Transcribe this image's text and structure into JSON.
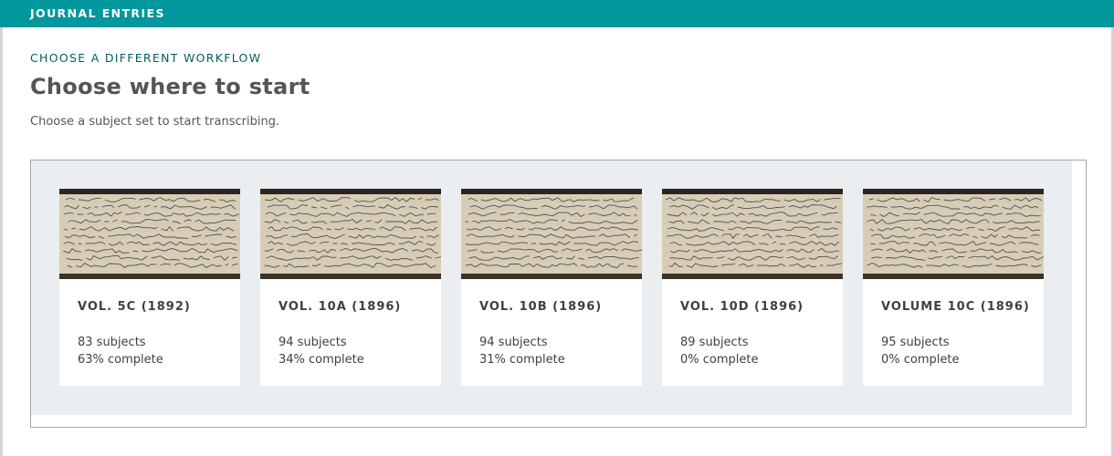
{
  "header": {
    "title": "JOURNAL ENTRIES",
    "color": "#00979d"
  },
  "workflow_link": "CHOOSE A DIFFERENT WORKFLOW",
  "page_title": "Choose where to start",
  "subtitle": "Choose a subject set to start transcribing.",
  "subject_sets": [
    {
      "title": "VOL. 5C (1892)",
      "subjects": "83 subjects",
      "complete": "63% complete",
      "thumbnail_icon": "handwritten-journal-page"
    },
    {
      "title": "VOL. 10A (1896)",
      "subjects": "94 subjects",
      "complete": "34% complete",
      "thumbnail_icon": "handwritten-journal-page"
    },
    {
      "title": "VOL. 10B (1896)",
      "subjects": "94 subjects",
      "complete": "31% complete",
      "thumbnail_icon": "handwritten-journal-page"
    },
    {
      "title": "VOL. 10D (1896)",
      "subjects": "89 subjects",
      "complete": "0% complete",
      "thumbnail_icon": "handwritten-journal-page"
    },
    {
      "title": "VOLUME 10C (1896)",
      "subjects": "95 subjects",
      "complete": "0% complete",
      "thumbnail_icon": "handwritten-journal-page"
    }
  ]
}
